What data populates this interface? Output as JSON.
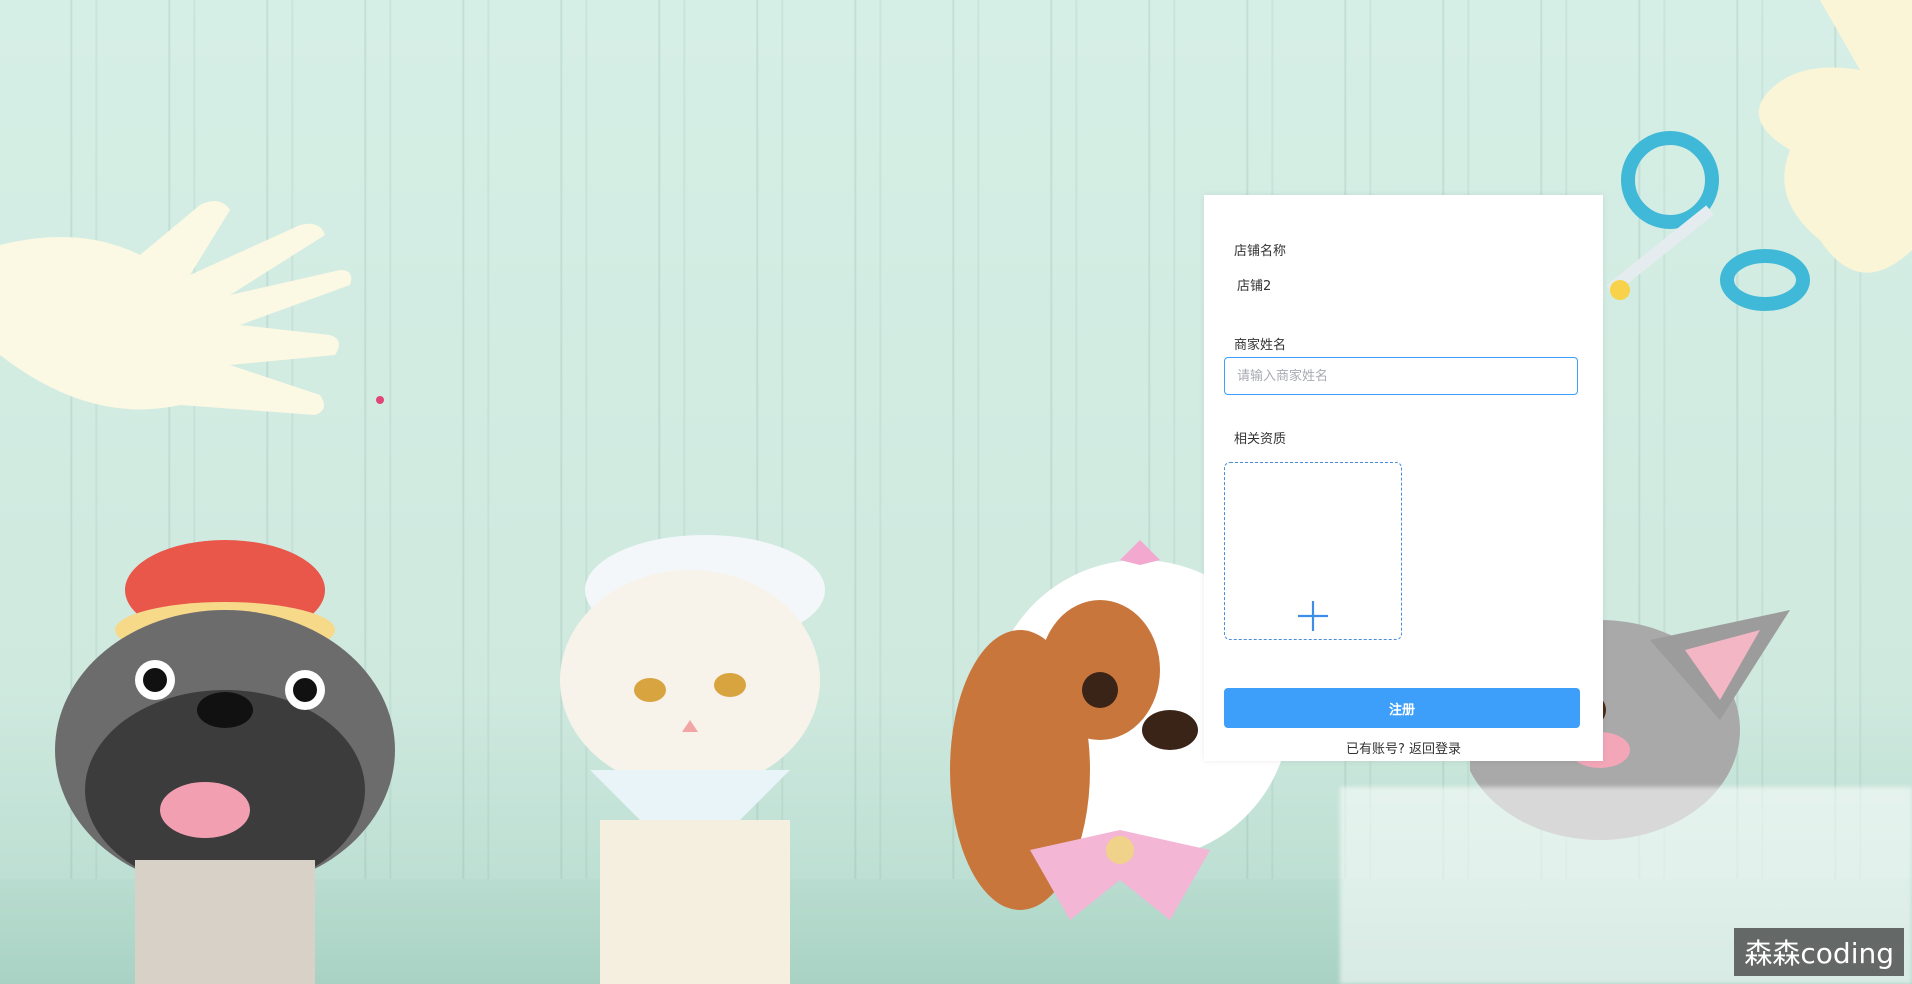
{
  "form": {
    "shop_name_label": "店铺名称",
    "shop_name_value": "店铺2",
    "merchant_name_label": "商家姓名",
    "merchant_name_placeholder": "请输入商家姓名",
    "merchant_name_value": "",
    "qualification_label": "相关资质",
    "upload_icon": "plus-icon",
    "submit_label": "注册",
    "have_account_text": "已有账号?",
    "back_to_login_text": "返回登录"
  },
  "watermark": {
    "text": "森森coding"
  },
  "colors": {
    "accent": "#3d9ff9",
    "input_border": "#409eff",
    "upload_border": "#4a8cd8",
    "background": "#d6efe6"
  }
}
